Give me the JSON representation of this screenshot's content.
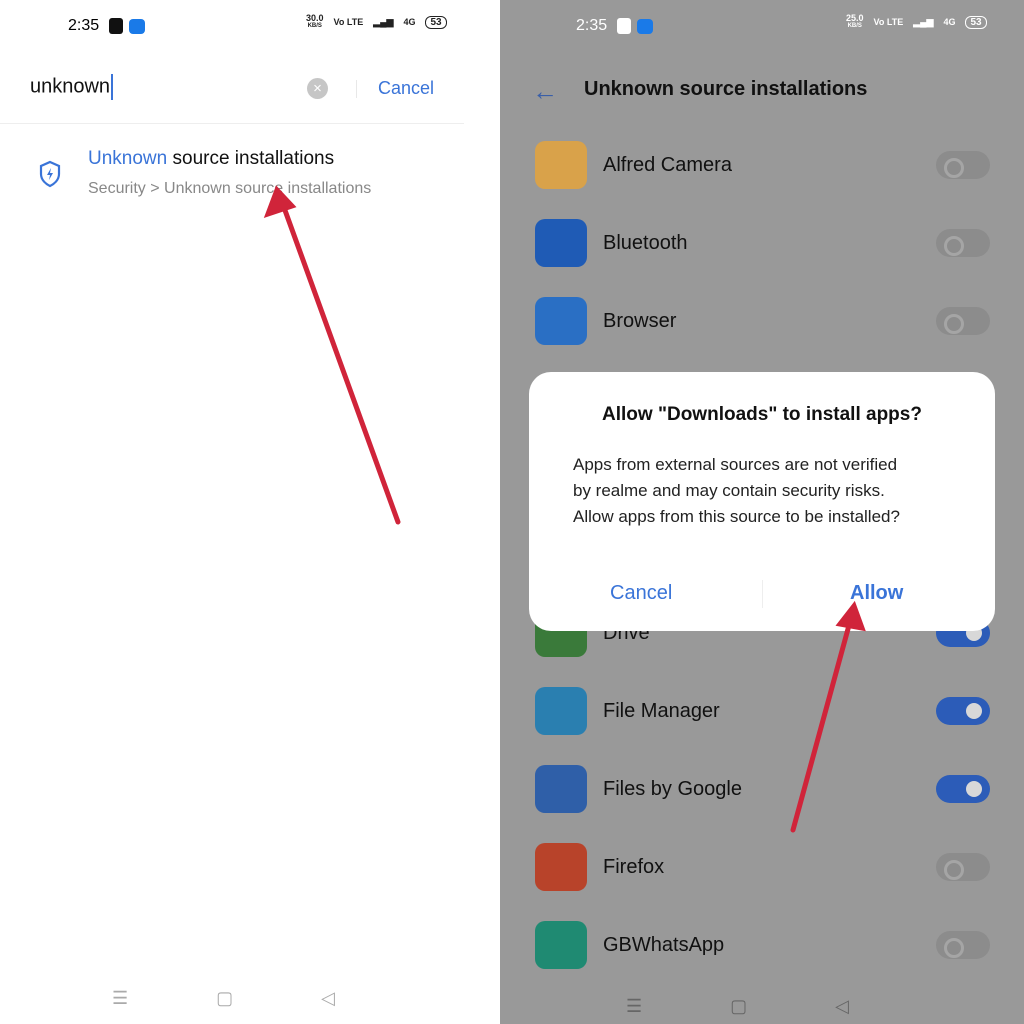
{
  "left": {
    "status": {
      "time": "2:35",
      "speed": "30.0",
      "speed_unit": "KB/S",
      "volte": "Vo LTE",
      "net": "4G",
      "battery": "53"
    },
    "search": {
      "value": "unknown",
      "cancel_label": "Cancel",
      "clear_icon": "clear-icon"
    },
    "result": {
      "title_highlight": "Unknown",
      "title_rest": " source installations",
      "subtitle": "Security > Unknown source installations",
      "icon": "shield-bolt-icon"
    },
    "nav": [
      "menu-icon",
      "home-icon",
      "back-icon"
    ]
  },
  "right": {
    "status": {
      "time": "2:35",
      "speed": "25.0",
      "speed_unit": "KB/S",
      "volte": "Vo LTE",
      "net": "4G",
      "battery": "53"
    },
    "header": {
      "title": "Unknown source installations"
    },
    "apps": [
      {
        "name": "Alfred Camera",
        "enabled": false,
        "color": "#d9a24a"
      },
      {
        "name": "Bluetooth",
        "enabled": false,
        "color": "#1f5bb5"
      },
      {
        "name": "Browser",
        "enabled": false,
        "color": "#2a6fc4"
      },
      {
        "name": "Drive",
        "enabled": true,
        "color": "#3a7a3a"
      },
      {
        "name": "File Manager",
        "enabled": true,
        "color": "#2a7fb0"
      },
      {
        "name": "Files by Google",
        "enabled": true,
        "color": "#2f5fa8"
      },
      {
        "name": "Firefox",
        "enabled": false,
        "color": "#b8432a"
      },
      {
        "name": "GBWhatsApp",
        "enabled": false,
        "color": "#1f8a72"
      }
    ],
    "dialog": {
      "title": "Allow \"Downloads\" to install apps?",
      "body": "Apps from external sources are not verified by realme and may contain security risks. Allow apps from this source to be installed?",
      "cancel_label": "Cancel",
      "allow_label": "Allow"
    }
  },
  "colors": {
    "accent": "#3a74d8",
    "arrow": "#d0243a",
    "scrim": "#999999"
  }
}
